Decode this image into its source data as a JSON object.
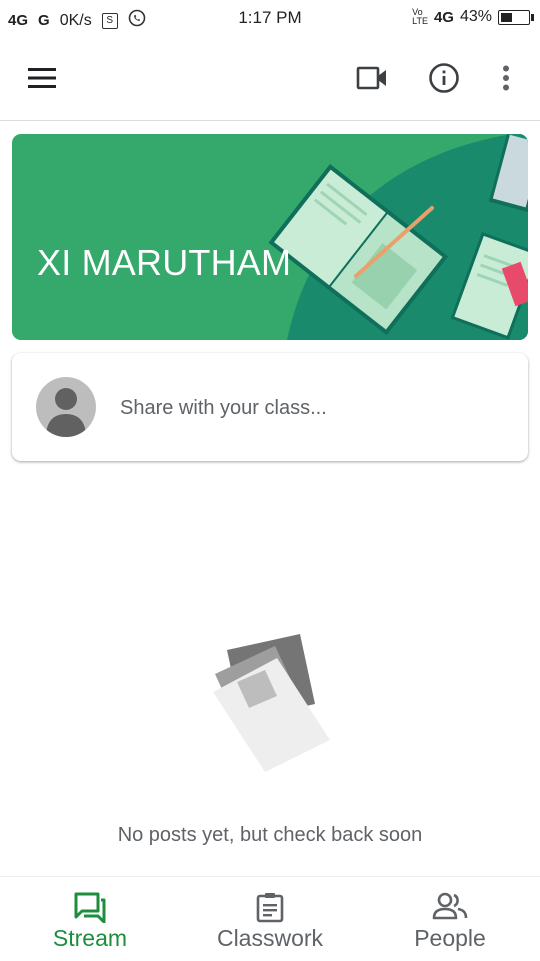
{
  "status_bar": {
    "left_signal_1": "4G",
    "left_signal_2": "G",
    "net_speed": "0K/s",
    "time": "1:17 PM",
    "right_network": "4G",
    "battery": "43%"
  },
  "app_bar": {
    "menu_icon": "hamburger-menu-icon",
    "video_icon": "video-camera-icon",
    "info_icon": "info-circle-icon",
    "more_icon": "more-vertical-icon"
  },
  "banner": {
    "class_name": "XI MARUTHAM",
    "color": "#34a96b"
  },
  "share": {
    "placeholder": "Share with your class..."
  },
  "empty_state": {
    "message": "No posts yet, but check back soon"
  },
  "bottom_nav": {
    "items": [
      {
        "label": "Stream",
        "icon": "stream-icon",
        "active": true
      },
      {
        "label": "Classwork",
        "icon": "classwork-icon",
        "active": false
      },
      {
        "label": "People",
        "icon": "people-icon",
        "active": false
      }
    ],
    "active_color": "#1e8e3e"
  }
}
